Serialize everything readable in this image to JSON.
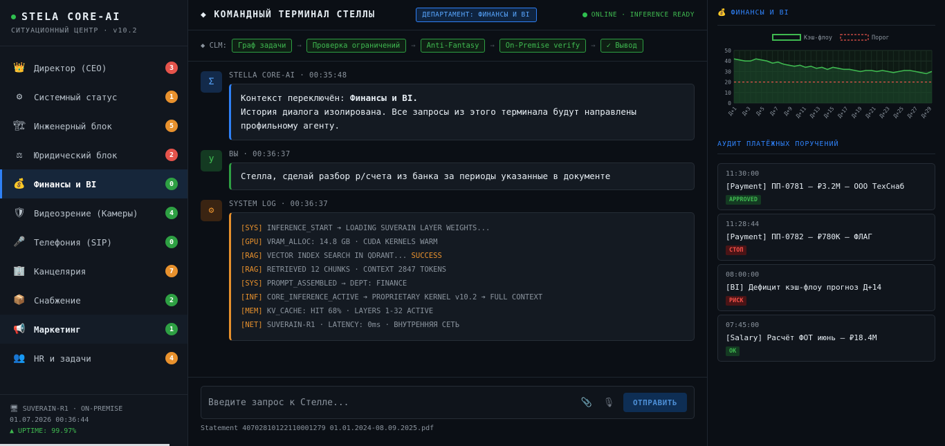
{
  "sidebar": {
    "brand": "STELA CORE-AI",
    "subtitle": "СИТУАЦИОННЫЙ ЦЕНТР · v10.2",
    "items": [
      {
        "icon": "👑",
        "label": "Директор (CEO)",
        "count": "3",
        "color": "red"
      },
      {
        "icon": "⚙",
        "label": "Системный статус",
        "count": "1",
        "color": "orange"
      },
      {
        "icon": "🏗",
        "label": "Инженерный блок",
        "count": "5",
        "color": "orange"
      },
      {
        "icon": "⚖",
        "label": "Юридический блок",
        "count": "2",
        "color": "red"
      },
      {
        "icon": "💰",
        "label": "Финансы и BI",
        "count": "0",
        "color": "green"
      },
      {
        "icon": "🛡",
        "label": "Видеозрение (Камеры)",
        "count": "4",
        "color": "green"
      },
      {
        "icon": "🎤",
        "label": "Телефония (SIP)",
        "count": "0",
        "color": "green"
      },
      {
        "icon": "🏢",
        "label": "Канцелярия",
        "count": "7",
        "color": "orange"
      },
      {
        "icon": "📦",
        "label": "Снабжение",
        "count": "2",
        "color": "green"
      },
      {
        "icon": "📢",
        "label": "Маркетинг",
        "count": "1",
        "color": "green"
      },
      {
        "icon": "👥",
        "label": "HR и задачи",
        "count": "4",
        "color": "orange"
      }
    ],
    "footer": {
      "node": "🖥 SUVERAIN-R1 · ON-PREMISE",
      "datetime": "01.07.2026 00:36:44",
      "uptime": "▲ UPTIME: 99.97%"
    }
  },
  "header": {
    "title": "КОМАНДНЫЙ ТЕРМИНАЛ СТЕЛЛЫ",
    "title_icon": "◆",
    "department": "ДЕПАРТАМЕНТ: ФИНАНСЫ И BI",
    "status": "ONLINE · INFERENCE READY"
  },
  "clm": {
    "label": "◆ CLM:",
    "steps": [
      "Граф задачи",
      "Проверка ограничений",
      "Anti-Fantasy",
      "On-Premise verify",
      "✓ Вывод"
    ]
  },
  "messages": {
    "ai": {
      "avatar": "Σ",
      "meta": "STELLA CORE-AI · 00:35:48",
      "line1_prefix": "Контекст переключён: ",
      "line1_bold": "Финансы и BI.",
      "line2": "История диалога изолирована. Все запросы из этого терминала будут направлены профильному агенту."
    },
    "user": {
      "avatar": "У",
      "meta": "ВЫ · 00:36:37",
      "text": "Стелла, сделай разбор р/счета из банка за периоды указанные в документе"
    },
    "system": {
      "avatar": "⚙",
      "meta": "SYSTEM LOG · 00:36:37",
      "lines": [
        {
          "tag": "[SYS]",
          "text": " INFERENCE_START ➔ LOADING SUVERAIN LAYER WEIGHTS..."
        },
        {
          "tag": "[GPU]",
          "text": " VRAM_ALLOC: 14.8 GB · CUDA KERNELS WARM"
        },
        {
          "tag": "[RAG]",
          "text": " VECTOR INDEX SEARCH IN QDRANT... ",
          "extra": "SUCCESS"
        },
        {
          "tag": "[RAG]",
          "text": " RETRIEVED 12 CHUNKS · CONTEXT 2847 TOKENS"
        },
        {
          "tag": "[SYS]",
          "text": " PROMPT_ASSEMBLED → DEPT: FINANCE"
        },
        {
          "tag": "[INF]",
          "text": " CORE_INFERENCE_ACTIVE ➔ PROPRIETARY KERNEL v10.2 ➔ FULL CONTEXT"
        },
        {
          "tag": "[MEM]",
          "text": " KV_CACHE: HIT 68% · LAYERS 1-32 ACTIVE"
        },
        {
          "tag": "[NET]",
          "text": " SUVERAIN-R1 · LATENCY: 0ms · ВНУТРЕННЯЯ СЕТЬ"
        }
      ]
    }
  },
  "composer": {
    "placeholder": "Введите запрос к Стелле...",
    "send_label": "ОТПРАВИТЬ",
    "attachment": "Statement 40702810122110001279 01.01.2024-08.09.2025.pdf"
  },
  "right": {
    "panel_title": "ФИНАНСЫ И BI",
    "panel_icon": "💰",
    "audit_title": "АУДИТ ПЛАТЁЖНЫХ ПОРУЧЕНИЙ",
    "audit": [
      {
        "time": "11:30:00",
        "text": "[Payment] ПП-0781 — ₽3.2M — ООО ТехСнаб",
        "status": "APPROVED",
        "color": "green"
      },
      {
        "time": "11:28:44",
        "text": "[Payment] ПП-0782 — ₽780K — ФЛАГ",
        "status": "СТОП",
        "color": "red"
      },
      {
        "time": "08:00:00",
        "text": "[BI] Дефицит кэш-флоу прогноз Д+14",
        "status": "РИСК",
        "color": "red"
      },
      {
        "time": "07:45:00",
        "text": "[Salary] Расчёт ФОТ июнь — ₽18.4M",
        "status": "OK",
        "color": "green"
      }
    ]
  },
  "chart_data": {
    "type": "line",
    "legend_placement": "top-center",
    "series": [
      {
        "name": "Кэш-флоу",
        "color": "#3fb950",
        "style": "solid-area",
        "values": [
          42,
          41,
          40,
          40,
          42,
          41,
          40,
          38,
          39,
          37,
          36,
          35,
          36,
          34,
          35,
          33,
          34,
          32,
          34,
          33,
          32,
          32,
          31,
          30,
          31,
          31,
          30,
          31,
          30,
          29,
          30,
          31,
          31,
          30,
          29,
          28,
          30
        ]
      },
      {
        "name": "Порог",
        "color": "#e5534b",
        "style": "dashed",
        "values": [
          20,
          20,
          20,
          20,
          20,
          20,
          20,
          20,
          20,
          20,
          20,
          20,
          20,
          20,
          20,
          20,
          20,
          20,
          20,
          20,
          20,
          20,
          20,
          20,
          20,
          20,
          20,
          20,
          20,
          20,
          20,
          20,
          20,
          20,
          20,
          20,
          20
        ]
      }
    ],
    "xticks": [
      "Д+1",
      "Д+3",
      "Д+5",
      "Д+7",
      "Д+9",
      "Д+11",
      "Д+13",
      "Д+15",
      "Д+17",
      "Д+19",
      "Д+21",
      "Д+23",
      "Д+25",
      "Д+27",
      "Д+29"
    ],
    "yticks": [
      0,
      10,
      20,
      30,
      40,
      50
    ],
    "ylim": [
      0,
      50
    ],
    "grid": true
  }
}
